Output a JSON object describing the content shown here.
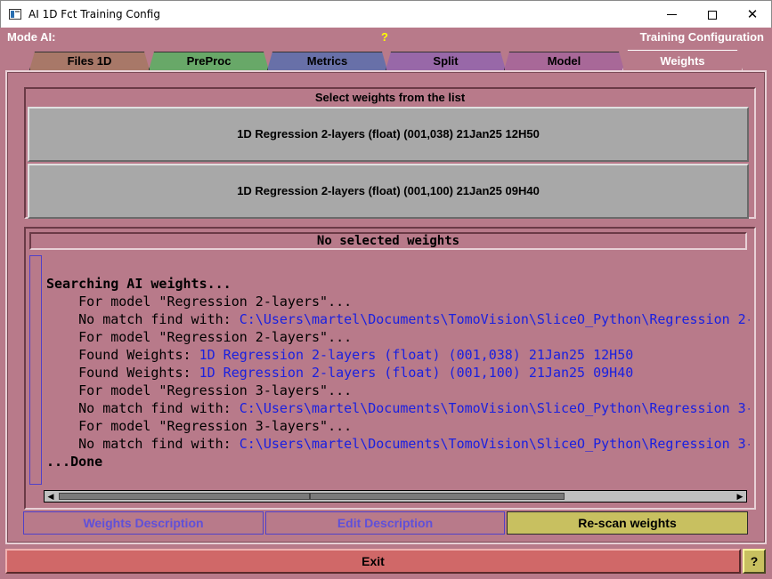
{
  "window": {
    "title": "AI 1D Fct Training Config",
    "minimize_icon": "minimize-icon",
    "maximize_icon": "maximize-icon",
    "close_glyph": "✕"
  },
  "header": {
    "mode_label": "Mode AI:",
    "help": "?",
    "right_title": "Training Configuration"
  },
  "tabs": [
    {
      "label": "Files 1D",
      "color": "#a87868"
    },
    {
      "label": "PreProc",
      "color": "#68a868"
    },
    {
      "label": "Metrics",
      "color": "#6870a8"
    },
    {
      "label": "Split",
      "color": "#9868a8"
    },
    {
      "label": "Model",
      "color": "#a86898"
    },
    {
      "label": "Weights",
      "color": "#b87a8a",
      "active": true
    }
  ],
  "select": {
    "title": "Select weights from the list",
    "items": [
      "1D Regression 2-layers (float) (001,038) 21Jan25 12H50",
      "1D Regression 2-layers (float) (001,100) 21Jan25 09H40"
    ]
  },
  "log": {
    "status": "No selected weights",
    "lines": [
      {
        "prefix": "Searching AI weights...",
        "rest": "",
        "bold": true
      },
      {
        "prefix": "    For model \"Regression 2-layers\"...",
        "rest": ""
      },
      {
        "prefix": "    No match find with: ",
        "rest": "C:\\Users\\martel\\Documents\\TomoVision\\SliceO_Python\\Regression 2-"
      },
      {
        "prefix": "    For model \"Regression 2-layers\"...",
        "rest": ""
      },
      {
        "prefix": "    Found Weights: ",
        "rest": "1D Regression 2-layers (float) (001,038) 21Jan25 12H50"
      },
      {
        "prefix": "    Found Weights: ",
        "rest": "1D Regression 2-layers (float) (001,100) 21Jan25 09H40"
      },
      {
        "prefix": "    For model \"Regression 3-layers\"...",
        "rest": ""
      },
      {
        "prefix": "    No match find with: ",
        "rest": "C:\\Users\\martel\\Documents\\TomoVision\\SliceO_Python\\Regression 3-"
      },
      {
        "prefix": "    For model \"Regression 3-layers\"...",
        "rest": ""
      },
      {
        "prefix": "    No match find with: ",
        "rest": "C:\\Users\\martel\\Documents\\TomoVision\\SliceO_Python\\Regression 3-"
      },
      {
        "prefix": "...Done",
        "rest": "",
        "bold": true
      }
    ]
  },
  "buttons": {
    "weights_description": "Weights Description",
    "edit_description": "Edit Description",
    "rescan": "Re-scan weights",
    "exit": "Exit",
    "exit_help": "?"
  },
  "scroll": {
    "left_arrow": "◀",
    "right_arrow": "▶"
  }
}
